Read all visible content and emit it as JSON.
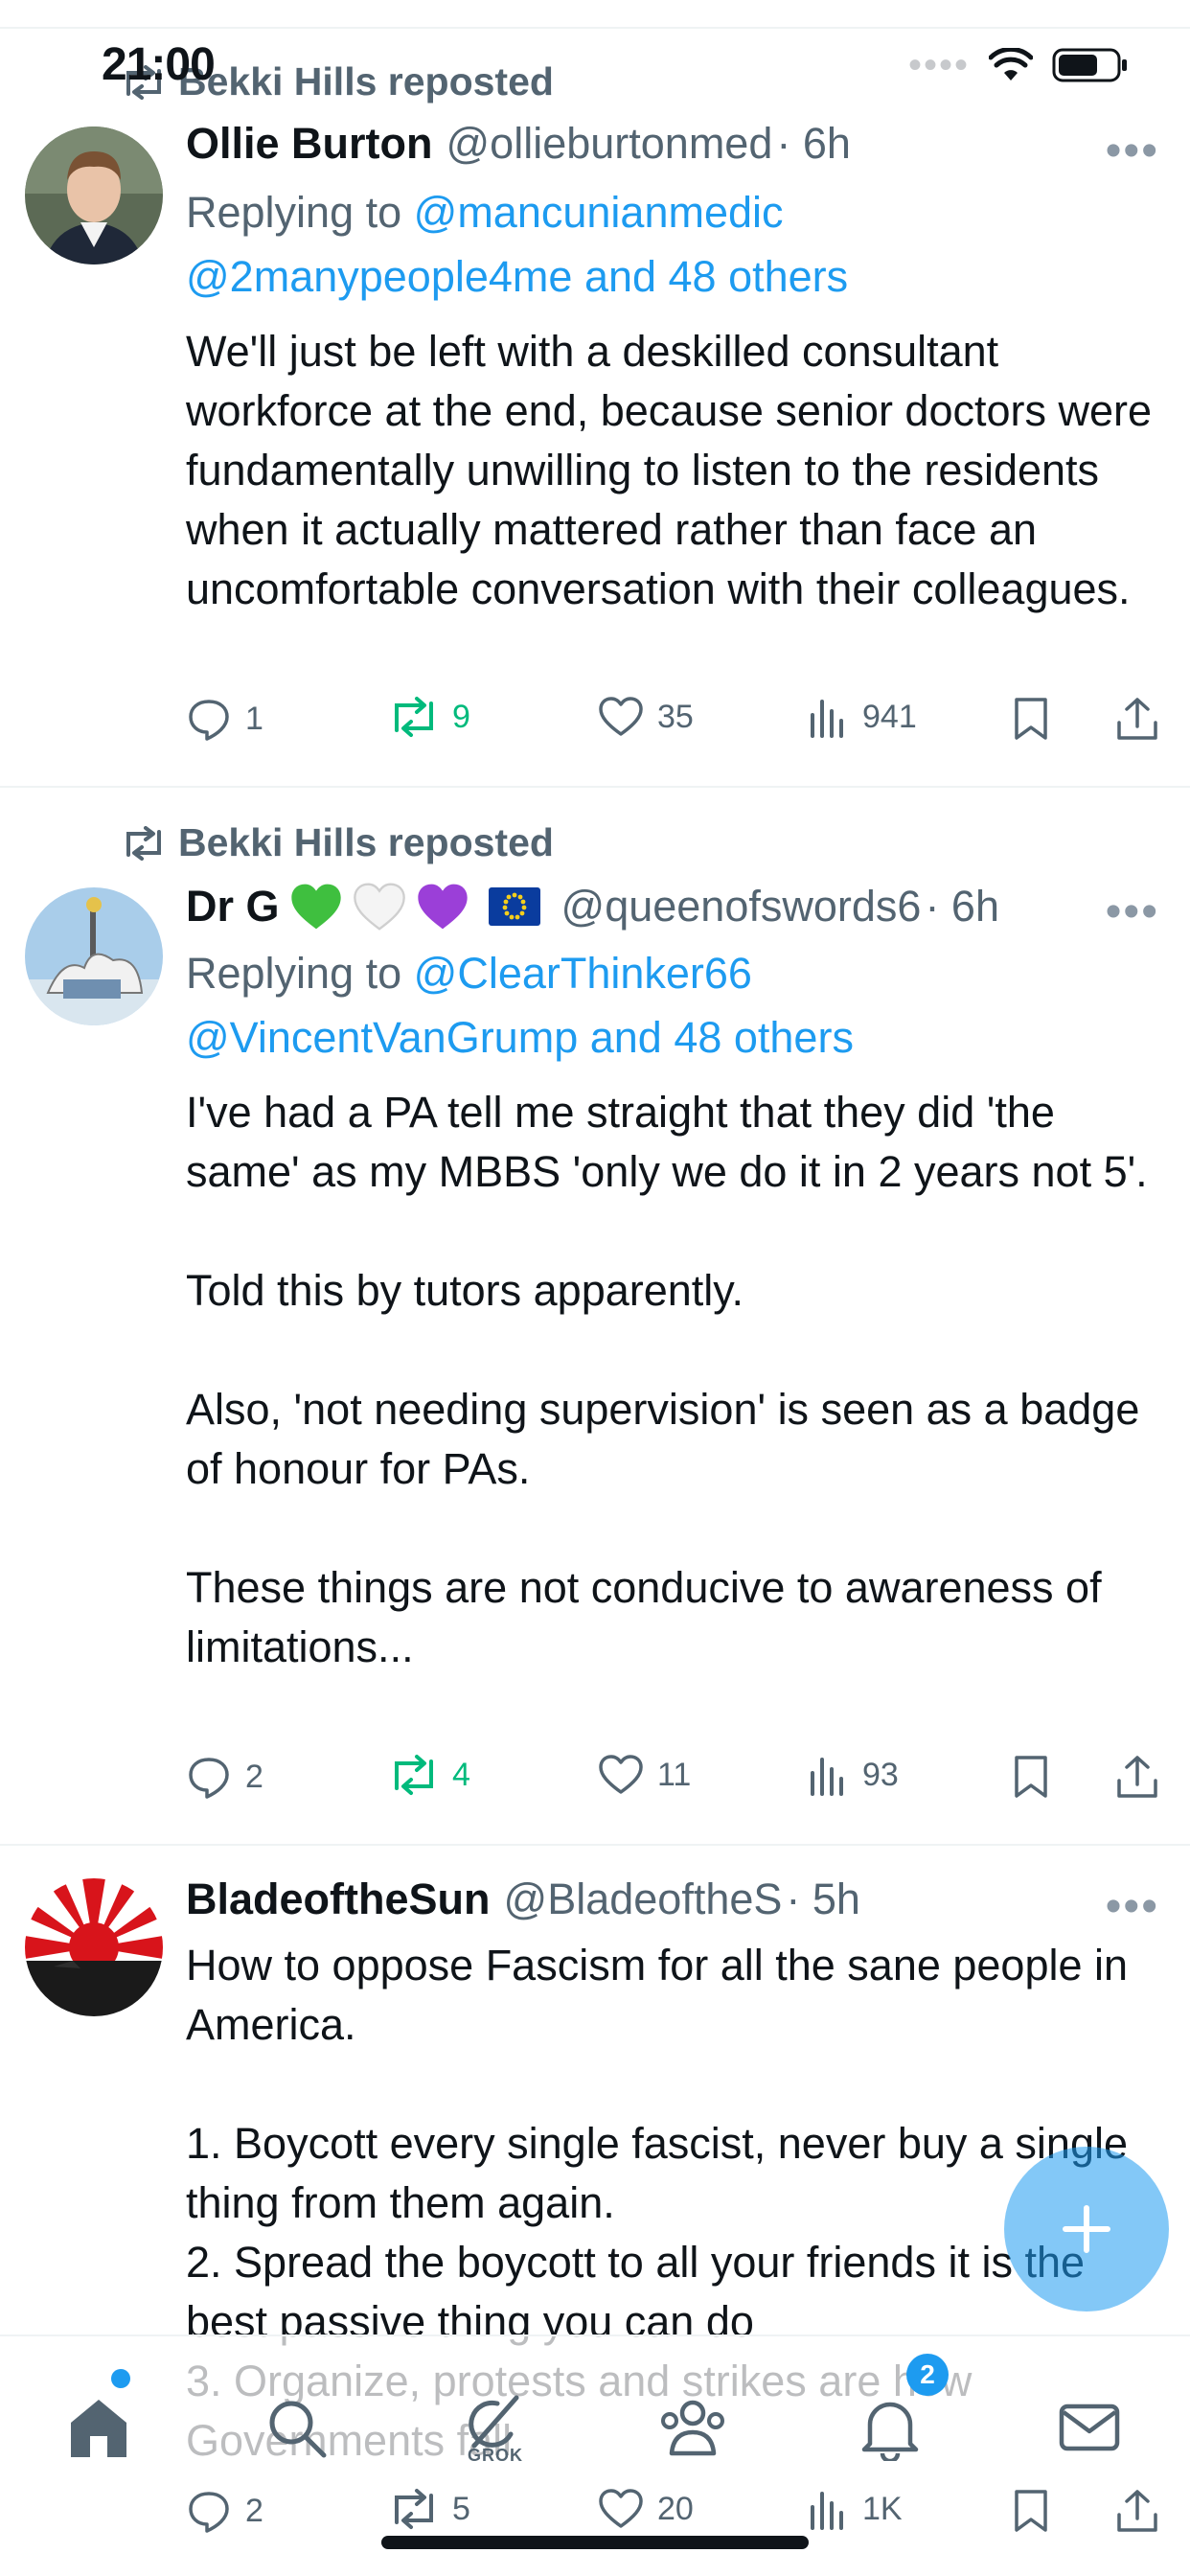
{
  "status_bar": {
    "time": "21:00"
  },
  "tweets": [
    {
      "reposted_by": "Bekki Hills reposted",
      "name": "Ollie Burton",
      "handle": "@ollieburtonmed",
      "time": "· 6h",
      "replying_label": "Replying to ",
      "replying_user1": "@mancunianmedic",
      "replying_user2": "@2manypeople4me",
      "replying_others": "and 48 others",
      "text": "We'll just be left with a deskilled consultant workforce at the end, because senior doctors were fundamentally unwilling to listen to the residents when it actually mattered rather than face an uncomfortable conversation with their colleagues.",
      "replies": "1",
      "reposts": "9",
      "likes": "35",
      "views": "941"
    },
    {
      "reposted_by": "Bekki Hills reposted",
      "name": "Dr G",
      "handle": "@queenofswords6",
      "time": "· 6h",
      "replying_label": "Replying to ",
      "replying_user1": "@ClearThinker66",
      "replying_user2": "@VincentVanGrump",
      "replying_others": "and 48 others",
      "text": "I've had a PA tell me straight that they did 'the same' as my MBBS 'only we do it in 2 years not 5'.\n\nTold this by tutors apparently.\n\nAlso, 'not needing supervision' is seen as a badge of honour for PAs.\n\nThese things are not conducive to awareness of limitations...",
      "replies": "2",
      "reposts": "4",
      "likes": "11",
      "views": "93"
    },
    {
      "name": "BladeoftheSun",
      "handle": "@BladeoftheS",
      "time": "· 5h",
      "text": "How to oppose Fascism for all the sane people in America.\n\n1. Boycott every single fascist, never buy a single thing from them again.\n2. Spread the boycott to all your friends it is the best passive thing you can do\n3. Organize, protests and strikes are how Governments fall",
      "replies": "2",
      "reposts": "5",
      "likes": "20",
      "views": "1K"
    }
  ],
  "tabbar": {
    "grok_label": "GROK",
    "notification_count": "2"
  },
  "colors": {
    "accent": "#1d9bf0",
    "repost_green": "#00ba7c",
    "secondary_text": "#536471"
  },
  "icons": [
    "repost-icon",
    "more-icon",
    "reply-icon",
    "like-icon",
    "views-icon",
    "bookmark-icon",
    "share-icon",
    "compose-icon",
    "home-icon",
    "search-icon",
    "grok-icon",
    "communities-icon",
    "bell-icon",
    "mail-icon"
  ]
}
